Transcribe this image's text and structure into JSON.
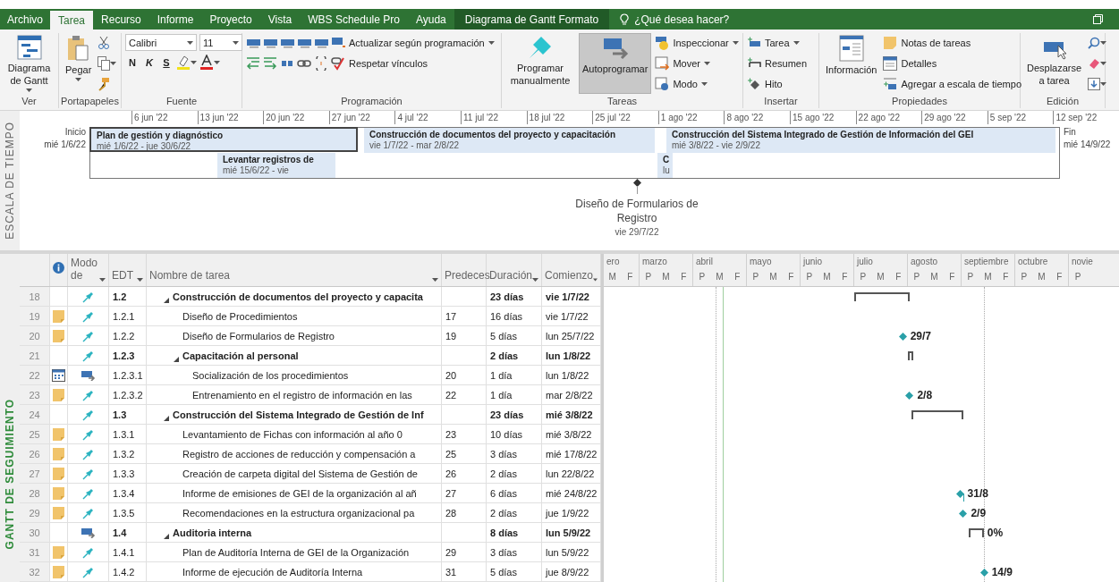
{
  "ribbon": {
    "tabs": [
      {
        "label": "Archivo",
        "kind": "file",
        "selected": false
      },
      {
        "label": "Tarea",
        "kind": "tab",
        "selected": true
      },
      {
        "label": "Recurso",
        "kind": "tab",
        "selected": false
      },
      {
        "label": "Informe",
        "kind": "tab",
        "selected": false
      },
      {
        "label": "Proyecto",
        "kind": "tab",
        "selected": false
      },
      {
        "label": "Vista",
        "kind": "tab",
        "selected": false
      },
      {
        "label": "WBS Schedule Pro",
        "kind": "tab",
        "selected": false
      },
      {
        "label": "Ayuda",
        "kind": "tab",
        "selected": false
      },
      {
        "label": "Diagrama de Gantt  Formato",
        "kind": "contextual",
        "selected": false
      }
    ],
    "tell_me": {
      "placeholder": "¿Qué desea hacer?"
    },
    "view": {
      "label": "Ver",
      "button": "Diagrama de Gantt"
    },
    "clipboard": {
      "label": "Portapapeles",
      "paste": "Pegar"
    },
    "font": {
      "label": "Fuente",
      "family": "Calibri",
      "size": "11",
      "bold": "N",
      "italic": "K",
      "underline": "S"
    },
    "schedule": {
      "label": "Programación",
      "update": "Actualizar según programación",
      "respect": "Respetar vínculos"
    },
    "tasks": {
      "label": "Tareas",
      "modes": [
        {
          "label": "Programar manualmente",
          "selected": false
        },
        {
          "label": "Autoprogramar",
          "selected": true
        }
      ],
      "commands": [
        "Inspeccionar",
        "Mover",
        "Modo"
      ]
    },
    "insert": {
      "label": "Insertar",
      "commands": [
        "Tarea",
        "Resumen",
        "Hito"
      ]
    },
    "properties": {
      "label": "Propiedades",
      "info": "Información",
      "commands": [
        "Notas de tareas",
        "Detalles",
        "Agregar a escala de tiempo"
      ]
    },
    "editing": {
      "label": "Edición",
      "scroll": "Desplazarse a tarea"
    }
  },
  "timeline": {
    "side_label": "ESCALA DE TIEMPO",
    "start_label": "Inicio",
    "start_date": "mié 1/6/22",
    "end_label": "Fin",
    "end_date": "mié 14/9/22",
    "ticks": [
      "6 jun '22",
      "13 jun '22",
      "20 jun '22",
      "27 jun '22",
      "4 jul '22",
      "11 jul '22",
      "18 jul '22",
      "25 jul '22",
      "1 ago '22",
      "8 ago '22",
      "15 ago '22",
      "22 ago '22",
      "29 ago '22",
      "5 sep '22",
      "12 sep '22"
    ],
    "bars": [
      {
        "title": "Plan de gestión y diagnóstico",
        "dates": "mié 1/6/22 - jue 30/6/22",
        "selected": true
      },
      {
        "title": "Construcción de documentos del proyecto y capacitación",
        "dates": "vie 1/7/22 - mar 2/8/22",
        "selected": false
      },
      {
        "title": "Construcción del Sistema Integrado de Gestión de Información del GEI",
        "dates": "mié 3/8/22 - vie 2/9/22",
        "selected": false
      },
      {
        "title": "Levantar registros de",
        "dates": "mié 15/6/22 - vie",
        "selected": false
      },
      {
        "title": "C",
        "dates": "lu",
        "selected": false
      }
    ],
    "milestone": {
      "title": "Diseño de Formularios de Registro",
      "date": "vie 29/7/22"
    }
  },
  "table": {
    "side_label": "GANTT DE SEGUIMIENTO",
    "columns": [
      "Modo de",
      "EDT",
      "Nombre de tarea",
      "Predeces",
      "Duración",
      "Comienzo"
    ],
    "rows": [
      {
        "id": "18",
        "kind": "summary",
        "expanded": true,
        "mode": {
          "kind": "manual"
        },
        "edt": "1.2",
        "name": "Construcción de documentos del proyecto y capacita",
        "duration": "23 días",
        "start": "vie 1/7/22",
        "bar": {
          "kind": "summary"
        },
        "children": [
          {
            "id": "19",
            "kind": "task",
            "indicator": {
              "kind": "note"
            },
            "mode": {
              "kind": "manual"
            },
            "edt": "1.2.1",
            "name": "Diseño de Procedimientos",
            "pred": "17",
            "duration": "16 días",
            "start": "vie 1/7/22"
          },
          {
            "id": "20",
            "kind": "task",
            "indicator": {
              "kind": "note"
            },
            "mode": {
              "kind": "manual"
            },
            "edt": "1.2.2",
            "name": "Diseño de Formularios de Registro",
            "pred": "19",
            "duration": "5 días",
            "start": "lun 25/7/22",
            "bar": {
              "kind": "milestone",
              "label": "29/7"
            }
          },
          {
            "id": "21",
            "kind": "summary",
            "expanded": true,
            "mode": {
              "kind": "manual"
            },
            "edt": "1.2.3",
            "name": "Capacitación al personal",
            "duration": "2 días",
            "start": "lun 1/8/22",
            "bar": {
              "kind": "summary"
            },
            "children": [
              {
                "id": "22",
                "kind": "task",
                "indicator": {
                  "kind": "calendar"
                },
                "mode": {
                  "kind": "auto"
                },
                "edt": "1.2.3.1",
                "name": "Socialización de los procedimientos",
                "pred": "20",
                "duration": "1 día",
                "start": "lun 1/8/22"
              },
              {
                "id": "23",
                "kind": "task",
                "indicator": {
                  "kind": "note"
                },
                "mode": {
                  "kind": "manual"
                },
                "edt": "1.2.3.2",
                "name": "Entrenamiento en el registro de información en las",
                "pred": "22",
                "duration": "1 día",
                "start": "mar 2/8/22",
                "bar": {
                  "kind": "milestone",
                  "label": "2/8"
                }
              }
            ]
          }
        ]
      },
      {
        "id": "24",
        "kind": "summary",
        "expanded": true,
        "mode": {
          "kind": "manual"
        },
        "edt": "1.3",
        "name": "Construcción del Sistema Integrado de Gestión de Inf",
        "duration": "23 días",
        "start": "mié 3/8/22",
        "bar": {
          "kind": "summary"
        },
        "children": [
          {
            "id": "25",
            "kind": "task",
            "indicator": {
              "kind": "note"
            },
            "mode": {
              "kind": "manual"
            },
            "edt": "1.3.1",
            "name": "Levantamiento de Fichas con información al año 0",
            "pred": "23",
            "duration": "10 días",
            "start": "mié 3/8/22"
          },
          {
            "id": "26",
            "kind": "task",
            "indicator": {
              "kind": "note"
            },
            "mode": {
              "kind": "manual"
            },
            "edt": "1.3.2",
            "name": "Registro de acciones de reducción y compensación a",
            "pred": "25",
            "duration": "3 días",
            "start": "mié 17/8/22"
          },
          {
            "id": "27",
            "kind": "task",
            "indicator": {
              "kind": "note"
            },
            "mode": {
              "kind": "manual"
            },
            "edt": "1.3.3",
            "name": "Creación de carpeta digital del Sistema de Gestión de",
            "pred": "26",
            "duration": "2 días",
            "start": "lun 22/8/22"
          },
          {
            "id": "28",
            "kind": "task",
            "indicator": {
              "kind": "note"
            },
            "mode": {
              "kind": "manual"
            },
            "edt": "1.3.4",
            "name": "Informe de emisiones de GEI de la organización al añ",
            "pred": "27",
            "duration": "6 días",
            "start": "mié 24/8/22",
            "bar": {
              "kind": "milestone",
              "label": "31/8"
            }
          },
          {
            "id": "29",
            "kind": "task",
            "indicator": {
              "kind": "note"
            },
            "mode": {
              "kind": "manual"
            },
            "edt": "1.3.5",
            "name": "Recomendaciones en la estructura organizacional pa",
            "pred": "28",
            "duration": "2 días",
            "start": "jue 1/9/22",
            "bar": {
              "kind": "milestone",
              "label": "2/9"
            }
          }
        ]
      },
      {
        "id": "30",
        "kind": "summary",
        "expanded": true,
        "mode": {
          "kind": "auto"
        },
        "edt": "1.4",
        "name": "Auditoria interna",
        "duration": "8 días",
        "start": "lun 5/9/22",
        "bar": {
          "kind": "summary",
          "label": "0%"
        },
        "children": [
          {
            "id": "31",
            "kind": "task",
            "indicator": {
              "kind": "note"
            },
            "mode": {
              "kind": "manual"
            },
            "edt": "1.4.1",
            "name": "Plan de Auditoría Interna de GEI de la Organización",
            "pred": "29",
            "duration": "3 días",
            "start": "lun 5/9/22"
          },
          {
            "id": "32",
            "kind": "task",
            "indicator": {
              "kind": "note"
            },
            "mode": {
              "kind": "manual"
            },
            "edt": "1.4.2",
            "name": "Informe de ejecución de Auditoría Interna",
            "pred": "31",
            "duration": "5 días",
            "start": "jue 8/9/22",
            "bar": {
              "kind": "milestone",
              "label": "14/9"
            }
          }
        ]
      }
    ]
  },
  "gantt": {
    "months": [
      {
        "label": "ero",
        "periods": [
          "M",
          "F"
        ]
      },
      {
        "label": "marzo",
        "periods": [
          "P",
          "M",
          "F"
        ]
      },
      {
        "label": "abril",
        "periods": [
          "P",
          "M",
          "F"
        ]
      },
      {
        "label": "mayo",
        "periods": [
          "P",
          "M",
          "F"
        ]
      },
      {
        "label": "junio",
        "periods": [
          "P",
          "M",
          "F"
        ]
      },
      {
        "label": "julio",
        "periods": [
          "P",
          "M",
          "F"
        ]
      },
      {
        "label": "agosto",
        "periods": [
          "P",
          "M",
          "F"
        ]
      },
      {
        "label": "septiembre",
        "periods": [
          "P",
          "M",
          "F"
        ]
      },
      {
        "label": "octubre",
        "periods": [
          "P",
          "M",
          "F"
        ]
      },
      {
        "label": "novie",
        "periods": [
          "P"
        ]
      }
    ]
  }
}
